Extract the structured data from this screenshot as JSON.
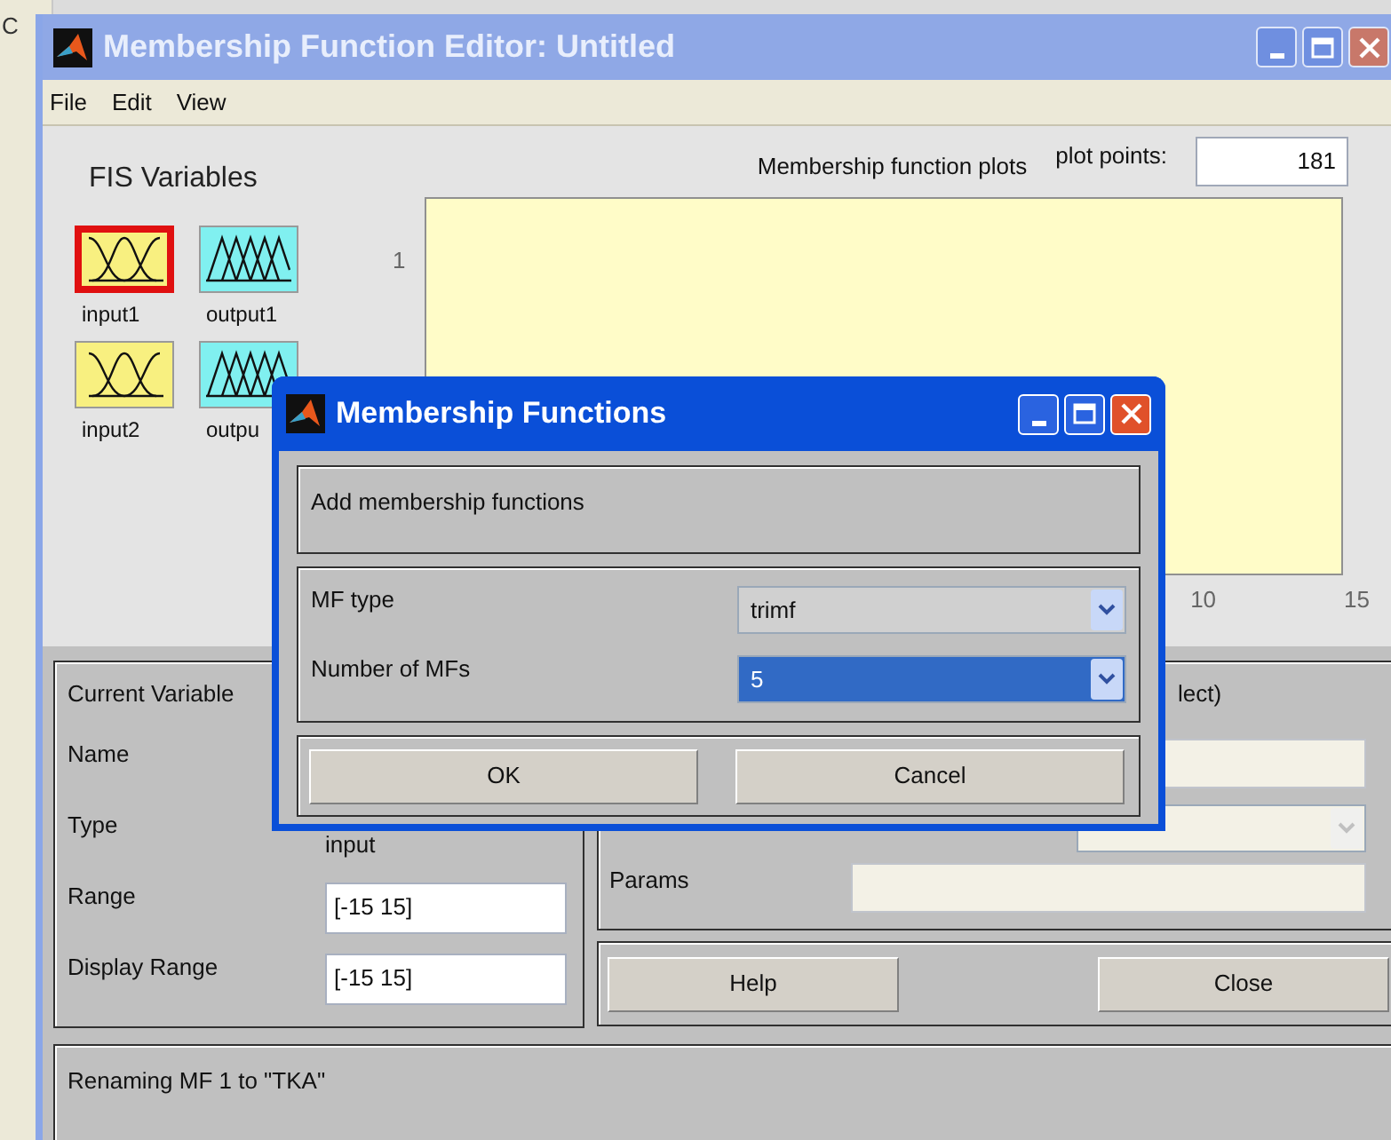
{
  "background_window": {
    "title": "C"
  },
  "window": {
    "title": "Membership Function Editor: Untitled",
    "active": false
  },
  "menu": [
    "File",
    "Edit",
    "View"
  ],
  "fis_variables": {
    "title": "FIS Variables",
    "items": [
      {
        "label": "input1",
        "kind": "input",
        "selected": true
      },
      {
        "label": "output1",
        "kind": "output",
        "selected": false
      },
      {
        "label": "input2",
        "kind": "input",
        "selected": false
      },
      {
        "label": "outpu",
        "kind": "output",
        "selected": false
      }
    ]
  },
  "plot": {
    "title": "Membership function plots",
    "plot_points_label": "plot points:",
    "plot_points": "181",
    "y_tick": "1",
    "x_ticks": [
      "10",
      "15"
    ]
  },
  "current_variable": {
    "title": "Current Variable",
    "rows": [
      {
        "label": "Name",
        "kind": "text"
      },
      {
        "label": "Type",
        "kind": "text",
        "value": "input"
      },
      {
        "label": "Range",
        "kind": "field",
        "value": "[-15 15]"
      },
      {
        "label": "Display Range",
        "kind": "field",
        "value": "[-15 15]"
      }
    ]
  },
  "current_mf": {
    "title": "lect)",
    "name_field": {
      "disabled": true
    },
    "type_dropdown": {
      "disabled": true
    },
    "params": {
      "label": "Params",
      "disabled": true
    }
  },
  "buttons": [
    "Help",
    "Close"
  ],
  "status": "Renaming MF 1 to \"TKA\"",
  "dialog": {
    "title": "Membership Functions",
    "active": true,
    "message": "Add membership functions",
    "fields": [
      {
        "label": "MF type",
        "value": "trimf",
        "focused": false
      },
      {
        "label": "Number of MFs",
        "value": "5",
        "focused": true
      }
    ],
    "buttons": [
      "OK",
      "Cancel"
    ]
  }
}
